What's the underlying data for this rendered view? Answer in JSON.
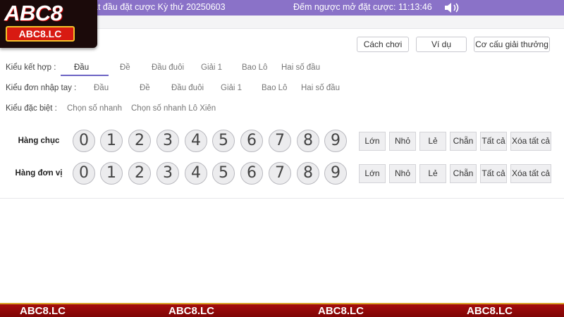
{
  "header": {
    "left_text": "ắt đầu đặt cược Kỳ thứ 20250603",
    "right_text": "Đếm ngược mở đặt cược: 11:13:46"
  },
  "logo": {
    "main": "ABC8",
    "badge": "ABC8.LC"
  },
  "toolbar": {
    "how_to_play": "Cách chơi",
    "example": "Ví dụ",
    "prize_structure": "Cơ cấu giải thưởng"
  },
  "bet_types": {
    "combo": {
      "label": "Kiểu kết hợp :",
      "options": [
        "Đầu",
        "Đề",
        "Đầu đuôi",
        "Giải 1",
        "Bao Lô",
        "Hai số đầu"
      ],
      "active_index": 0
    },
    "manual": {
      "label": "Kiểu đơn nhập tay :",
      "options": [
        "Đầu",
        "Đề",
        "Đầu đuôi",
        "Giải 1",
        "Bao Lô",
        "Hai số đầu"
      ]
    },
    "special": {
      "label": "Kiểu đặc biệt :",
      "options": [
        "Chọn số nhanh",
        "Chọn số nhanh Lô Xiên"
      ]
    }
  },
  "digit_rows": [
    {
      "label": "Hàng chục",
      "digits": [
        "0",
        "1",
        "2",
        "3",
        "4",
        "5",
        "6",
        "7",
        "8",
        "9"
      ]
    },
    {
      "label": "Hàng đơn vị",
      "digits": [
        "0",
        "1",
        "2",
        "3",
        "4",
        "5",
        "6",
        "7",
        "8",
        "9"
      ]
    }
  ],
  "quick_buttons": [
    "Lớn",
    "Nhỏ",
    "Lẻ",
    "Chẵn",
    "Tất cả",
    "Xóa tất cả"
  ],
  "footer_banner": [
    "ABC8.LC",
    "ABC8.LC",
    "ABC8.LC",
    "ABC8.LC"
  ],
  "colors": {
    "header_bg": "#8a72c8",
    "accent_underline": "#6c63c4",
    "banner_red": "#a50d0d",
    "banner_gold": "#d6a126"
  },
  "icons": {
    "speaker": "speaker-icon"
  }
}
